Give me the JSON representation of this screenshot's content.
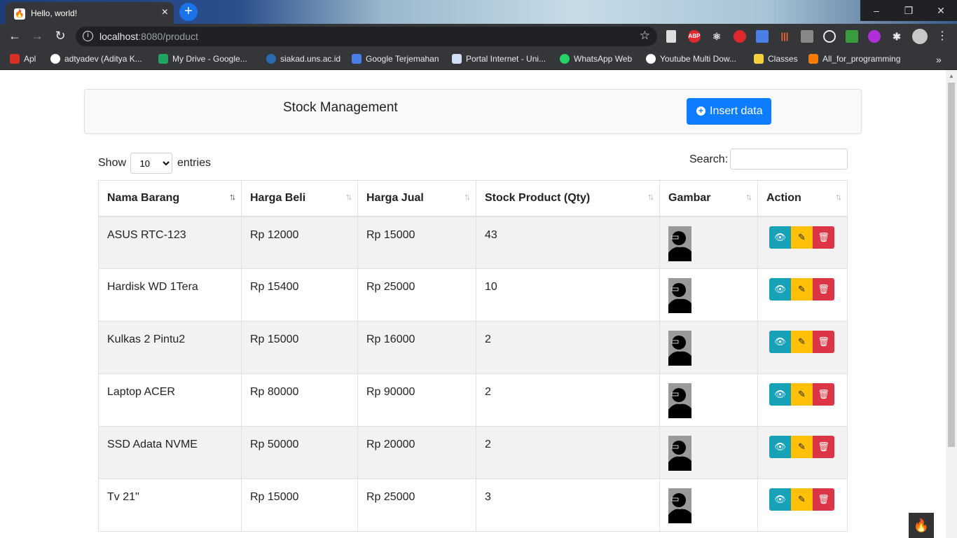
{
  "browser": {
    "tab_title": "Hello, world!",
    "url_host": "localhost",
    "url_rest": ":8080/product",
    "bookmarks": [
      "Apl",
      "adtyadev (Aditya K...",
      "My Drive - Google...",
      "siakad.uns.ac.id",
      "Google Terjemahan",
      "Portal Internet - Uni...",
      "WhatsApp Web",
      "Youtube Multi Dow...",
      "Classes",
      "All_for_programming"
    ],
    "extensions": [
      "ABP"
    ]
  },
  "header": {
    "title": "Stock Management",
    "insert_label": "Insert data"
  },
  "controls": {
    "show_label": "Show",
    "entries_value": "10",
    "entries_label": "entries",
    "search_label": "Search:",
    "search_value": ""
  },
  "table": {
    "columns": [
      "Nama Barang",
      "Harga Beli",
      "Harga Jual",
      "Stock Product (Qty)",
      "Gambar",
      "Action"
    ],
    "rows": [
      {
        "name": "ASUS RTC-123",
        "beli": "Rp 12000",
        "jual": "Rp 15000",
        "qty": "43"
      },
      {
        "name": "Hardisk WD 1Tera",
        "beli": "Rp 15400",
        "jual": "Rp 25000",
        "qty": "10"
      },
      {
        "name": "Kulkas 2 Pintu2",
        "beli": "Rp 15000",
        "jual": "Rp 16000",
        "qty": "2"
      },
      {
        "name": "Laptop ACER",
        "beli": "Rp 80000",
        "jual": "Rp 90000",
        "qty": "2"
      },
      {
        "name": "SSD Adata NVME",
        "beli": "Rp 50000",
        "jual": "Rp 20000",
        "qty": "2"
      },
      {
        "name": "Tv 21\"",
        "beli": "Rp 15000",
        "jual": "Rp 25000",
        "qty": "3"
      }
    ]
  },
  "colors": {
    "primary": "#0d7cff",
    "info": "#17a2b8",
    "warning": "#ffc107",
    "danger": "#dc3545"
  }
}
